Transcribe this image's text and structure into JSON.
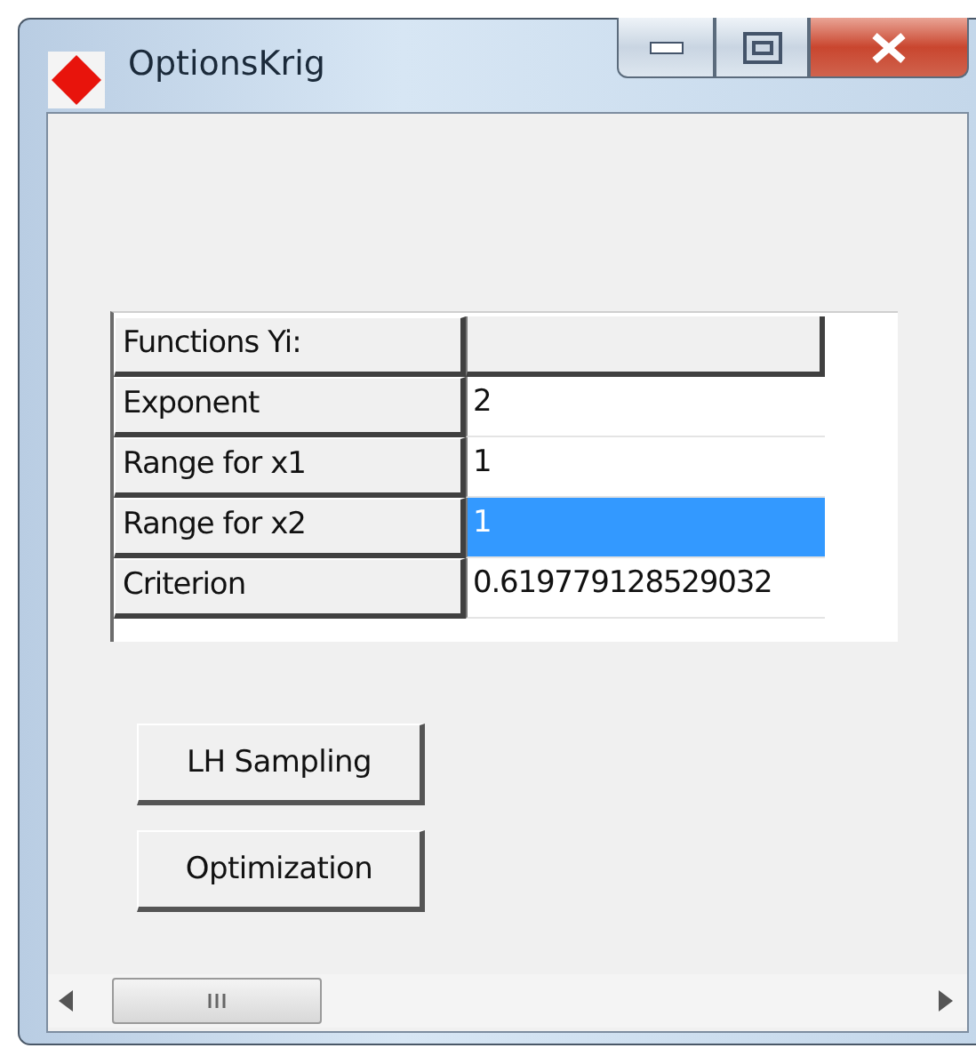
{
  "window": {
    "title": "OptionsKrig"
  },
  "grid": {
    "rows": [
      {
        "kind": "header",
        "label": "Functions Yi:",
        "value": "",
        "selected": false
      },
      {
        "kind": "value",
        "label": "Exponent",
        "value": "2",
        "selected": false
      },
      {
        "kind": "value",
        "label": "Range for x1",
        "value": "1",
        "selected": false
      },
      {
        "kind": "value",
        "label": "Range for x2",
        "value": "1",
        "selected": true
      },
      {
        "kind": "value",
        "label": "Criterion",
        "value": "0.619779128529032",
        "selected": false
      }
    ]
  },
  "buttons": [
    "LH Sampling",
    "Optimization"
  ]
}
